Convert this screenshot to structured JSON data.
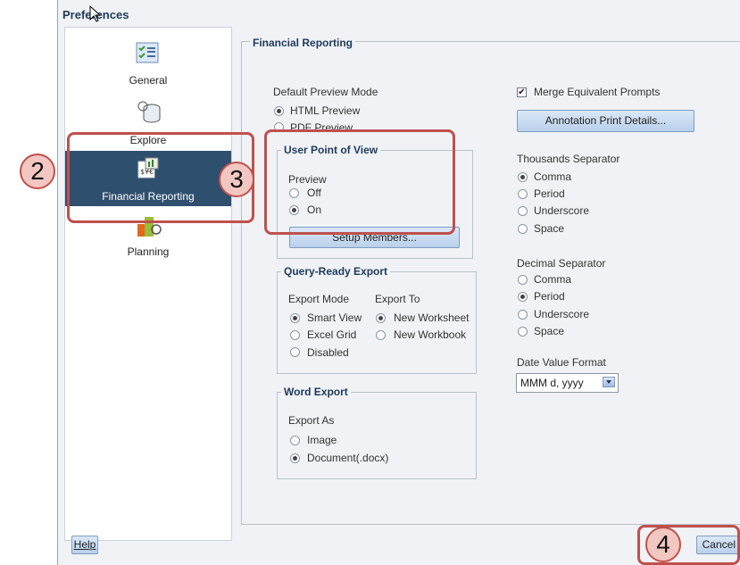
{
  "window": {
    "title": "Preferences"
  },
  "sidebar": {
    "items": [
      {
        "label": "General",
        "icon": "checklist-icon"
      },
      {
        "label": "Explore",
        "icon": "explore-icon"
      },
      {
        "label": "Financial Reporting",
        "icon": "financial-report-icon",
        "selected": true
      },
      {
        "label": "Planning",
        "icon": "planning-icon"
      }
    ]
  },
  "main": {
    "section_title": "Financial Reporting",
    "default_preview": {
      "label": "Default Preview Mode",
      "options": [
        {
          "label": "HTML Preview",
          "checked": true
        },
        {
          "label": "PDF Preview",
          "checked": false
        }
      ]
    },
    "user_pov": {
      "title": "User Point of View",
      "preview_label": "Preview",
      "options": [
        {
          "label": "Off",
          "checked": false
        },
        {
          "label": "On",
          "checked": true
        }
      ],
      "setup_button": "Setup Members..."
    },
    "query_ready": {
      "title": "Query-Ready Export",
      "mode_label": "Export Mode",
      "to_label": "Export To",
      "modes": [
        {
          "label": "Smart View",
          "checked": true
        },
        {
          "label": "Excel Grid",
          "checked": false
        },
        {
          "label": "Disabled",
          "checked": false
        }
      ],
      "targets": [
        {
          "label": "New Worksheet",
          "checked": true
        },
        {
          "label": "New Workbook",
          "checked": false
        }
      ]
    },
    "word_export": {
      "title": "Word Export",
      "as_label": "Export As",
      "options": [
        {
          "label": "Image",
          "checked": false
        },
        {
          "label": "Document(.docx)",
          "checked": true
        }
      ]
    },
    "merge": {
      "label": "Merge Equivalent Prompts",
      "checked": true
    },
    "annotation_button": "Annotation Print Details...",
    "thousands": {
      "label": "Thousands Separator",
      "options": [
        {
          "label": "Comma",
          "checked": true
        },
        {
          "label": "Period",
          "checked": false
        },
        {
          "label": "Underscore",
          "checked": false
        },
        {
          "label": "Space",
          "checked": false
        }
      ]
    },
    "decimal": {
      "label": "Decimal Separator",
      "options": [
        {
          "label": "Comma",
          "checked": false
        },
        {
          "label": "Period",
          "checked": true
        },
        {
          "label": "Underscore",
          "checked": false
        },
        {
          "label": "Space",
          "checked": false
        }
      ]
    },
    "date_format": {
      "label": "Date Value Format",
      "value": "MMM d, yyyy"
    }
  },
  "footer": {
    "help": "Help",
    "cancel": "Cancel"
  },
  "callouts": {
    "c2": "2",
    "c3": "3",
    "c4": "4"
  },
  "colors": {
    "accent": "#c0504d",
    "selected": "#2f4f6f",
    "title": "#1e3a5a"
  }
}
